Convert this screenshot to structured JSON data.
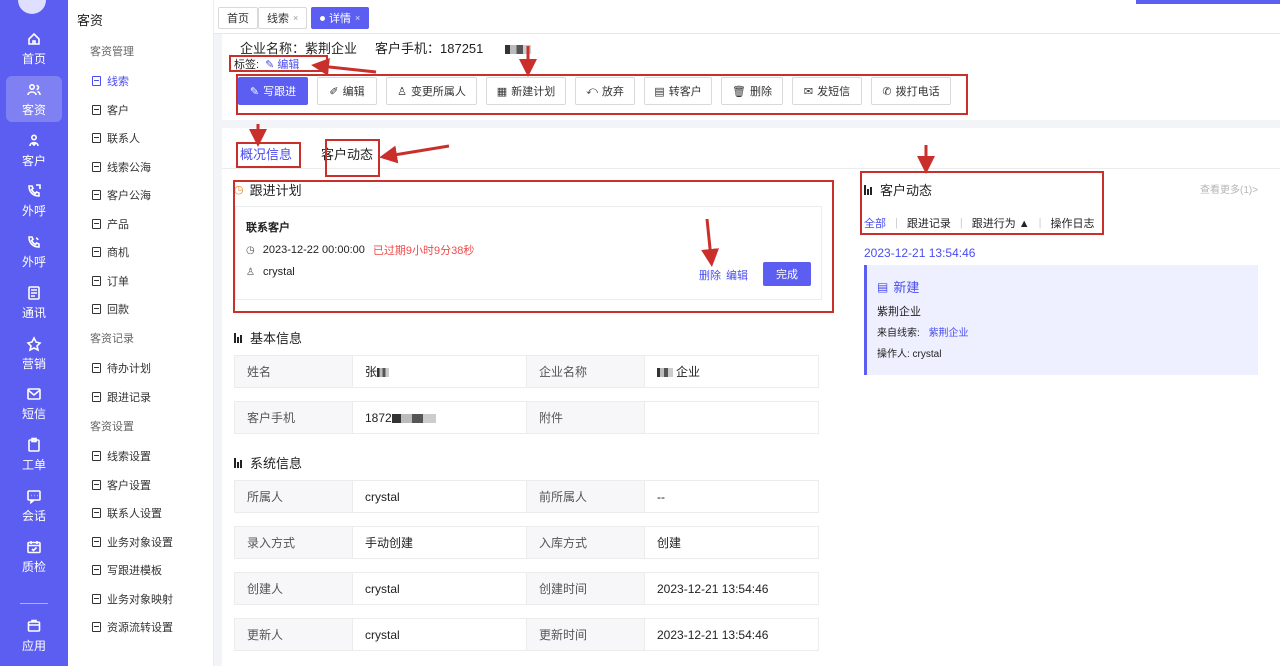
{
  "rail": {
    "items": [
      {
        "label": "首页",
        "icon": "home-icon"
      },
      {
        "label": "客资",
        "icon": "users-icon",
        "active": true
      },
      {
        "label": "客户",
        "icon": "person-icon"
      },
      {
        "label": "外呼",
        "icon": "phone-out-icon"
      },
      {
        "label": "外呼",
        "icon": "phone-call-icon"
      },
      {
        "label": "通讯",
        "icon": "contacts-icon"
      },
      {
        "label": "营销",
        "icon": "marketing-icon"
      },
      {
        "label": "短信",
        "icon": "message-icon"
      },
      {
        "label": "工单",
        "icon": "clipboard-icon"
      },
      {
        "label": "会话",
        "icon": "chat-icon"
      },
      {
        "label": "质检",
        "icon": "calendar-check-icon"
      },
      {
        "label": "应用",
        "icon": "app-icon"
      }
    ]
  },
  "submenu": {
    "title": "客资",
    "groups": [
      {
        "label": "客资管理",
        "items": [
          "线索",
          "客户",
          "联系人",
          "线索公海",
          "客户公海",
          "产品",
          "商机",
          "订单",
          "回款"
        ]
      },
      {
        "label": "客资记录",
        "items": [
          "待办计划",
          "跟进记录"
        ]
      },
      {
        "label": "客资设置",
        "items": [
          "线索设置",
          "客户设置",
          "联系人设置",
          "业务对象设置",
          "写跟进模板",
          "业务对象映射",
          "资源流转设置"
        ]
      }
    ],
    "active_item": "线索"
  },
  "tabs": {
    "home": "首页",
    "lead": "线索",
    "detail": "详情",
    "close": "×"
  },
  "header": {
    "company_label": "企业名称：紫荆企业",
    "phone_label": "客户手机：187251",
    "tag_label": "标签:",
    "tag_edit": "编辑"
  },
  "actions": [
    {
      "label": "写跟进",
      "icon": "pencil-icon",
      "primary": true
    },
    {
      "label": "编辑",
      "icon": "edit-icon"
    },
    {
      "label": "变更所属人",
      "icon": "person-icon"
    },
    {
      "label": "新建计划",
      "icon": "calendar-icon"
    },
    {
      "label": "放弃",
      "icon": "abandon-icon"
    },
    {
      "label": "转客户",
      "icon": "transfer-icon"
    },
    {
      "label": "删除",
      "icon": "trash-icon"
    },
    {
      "label": "发短信",
      "icon": "mail-icon"
    },
    {
      "label": "拨打电话",
      "icon": "phone-icon"
    }
  ],
  "content_tabs": {
    "overview": "概况信息",
    "activity": "客户动态"
  },
  "plan": {
    "title": "跟进计划",
    "contact_label": "联系客户",
    "datetime": "2023-12-22 00:00:00",
    "overdue": "已过期9小时9分38秒",
    "user": "crystal",
    "delete_link": "删除",
    "edit_link": "编辑",
    "done_button": "完成"
  },
  "basic_info": {
    "title": "基本信息",
    "rows": [
      {
        "label1": "姓名",
        "value1": "张",
        "label2": "企业名称",
        "value2": "企业"
      },
      {
        "label1": "客户手机",
        "value1": "1872",
        "label2": "附件",
        "value2": ""
      }
    ]
  },
  "system_info": {
    "title": "系统信息",
    "rows": [
      {
        "label1": "所属人",
        "value1": "crystal",
        "label2": "前所属人",
        "value2": "--"
      },
      {
        "label1": "录入方式",
        "value1": "手动创建",
        "label2": "入库方式",
        "value2": "创建"
      },
      {
        "label1": "创建人",
        "value1": "crystal",
        "label2": "创建时间",
        "value2": "2023-12-21 13:54:46"
      },
      {
        "label1": "更新人",
        "value1": "crystal",
        "label2": "更新时间",
        "value2": "2023-12-21 13:54:46"
      }
    ]
  },
  "dynamics": {
    "title": "客户动态",
    "more": "查看更多(1)>",
    "filters": [
      "全部",
      "跟进记录",
      "跟进行为 ▲",
      "操作日志"
    ],
    "date": "2023-12-21 13:54:46",
    "card": {
      "title": "新建",
      "company": "紫荆企业",
      "source_label": "来自线索:",
      "source_link": "紫荆企业",
      "operator_label": "操作人: crystal"
    }
  },
  "colors": {
    "brand": "#5b5ef0",
    "link": "#4a4df0",
    "overdue": "#ef4b4b",
    "annotation": "#c9302c"
  }
}
